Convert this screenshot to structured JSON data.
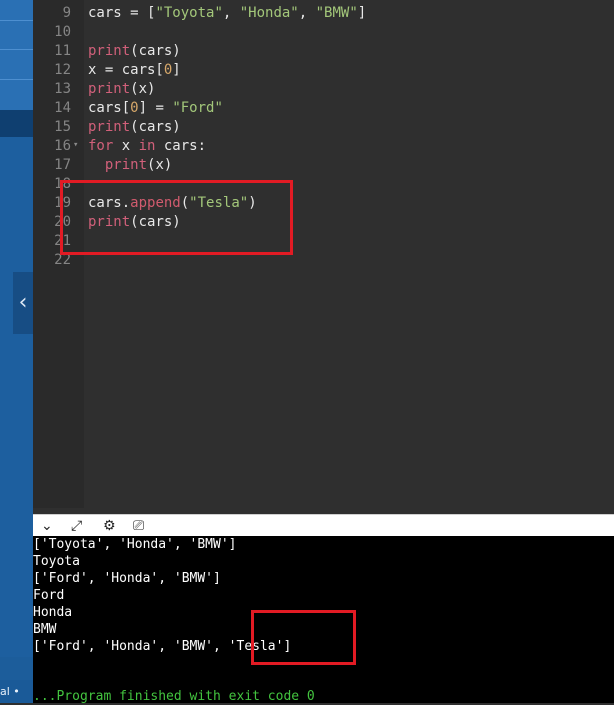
{
  "editor": {
    "lines": [
      {
        "num": "9",
        "text": "cars = [\"Toyota\", \"Honda\", \"BMW\"]"
      },
      {
        "num": "10",
        "text": ""
      },
      {
        "num": "11",
        "text": "print(cars)"
      },
      {
        "num": "12",
        "text": "x = cars[0]"
      },
      {
        "num": "13",
        "text": "print(x)"
      },
      {
        "num": "14",
        "text": "cars[0] = \"Ford\""
      },
      {
        "num": "15",
        "text": "print(cars)"
      },
      {
        "num": "16",
        "text": "for x in cars:"
      },
      {
        "num": "17",
        "text": "  print(x)"
      },
      {
        "num": "18",
        "text": ""
      },
      {
        "num": "19",
        "text": "cars.append(\"Tesla\")"
      },
      {
        "num": "20",
        "text": "print(cars)"
      },
      {
        "num": "21",
        "text": ""
      },
      {
        "num": "22",
        "text": ""
      }
    ]
  },
  "sidebar": {
    "collapse_glyph": "‹",
    "bottom_text": "al •"
  },
  "toolbar": {
    "icons": [
      "chevron-down-icon",
      "expand-icon",
      "gear-icon",
      "clear-console-icon"
    ]
  },
  "console": {
    "output": [
      "['Toyota', 'Honda', 'BMW']",
      "Toyota",
      "['Ford', 'Honda', 'BMW']",
      "Ford",
      "Honda",
      "BMW",
      "['Ford', 'Honda', 'BMW', 'Tesla']",
      "",
      "",
      "...Program finished with exit code 0"
    ]
  },
  "colors": {
    "highlight": "#e21b24",
    "sidebar": "#1c5d9b",
    "editor_bg": "#2f2f2f",
    "console_bg": "#000000",
    "finish_text": "#43c43f"
  }
}
